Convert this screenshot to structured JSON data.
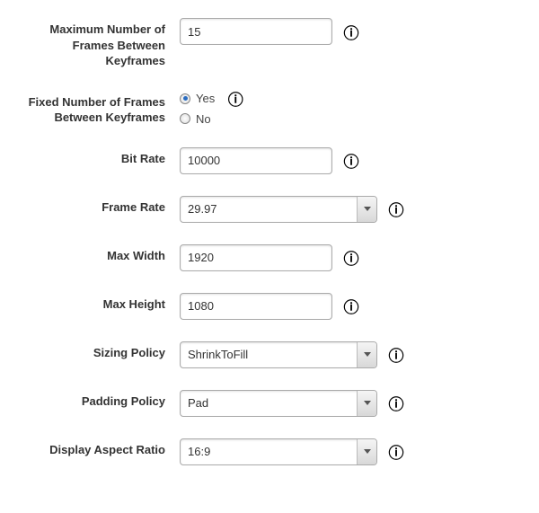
{
  "fields": {
    "max_frames_between_keyframes": {
      "label": "Maximum Number of Frames Between Keyframes",
      "value": "15"
    },
    "fixed_frames_between_keyframes": {
      "label": "Fixed Number of Frames Between Keyframes",
      "yes": "Yes",
      "no": "No",
      "selected": "Yes"
    },
    "bit_rate": {
      "label": "Bit Rate",
      "value": "10000"
    },
    "frame_rate": {
      "label": "Frame Rate",
      "value": "29.97"
    },
    "max_width": {
      "label": "Max Width",
      "value": "1920"
    },
    "max_height": {
      "label": "Max Height",
      "value": "1080"
    },
    "sizing_policy": {
      "label": "Sizing Policy",
      "value": "ShrinkToFill"
    },
    "padding_policy": {
      "label": "Padding Policy",
      "value": "Pad"
    },
    "display_aspect_ratio": {
      "label": "Display Aspect Ratio",
      "value": "16:9"
    }
  }
}
